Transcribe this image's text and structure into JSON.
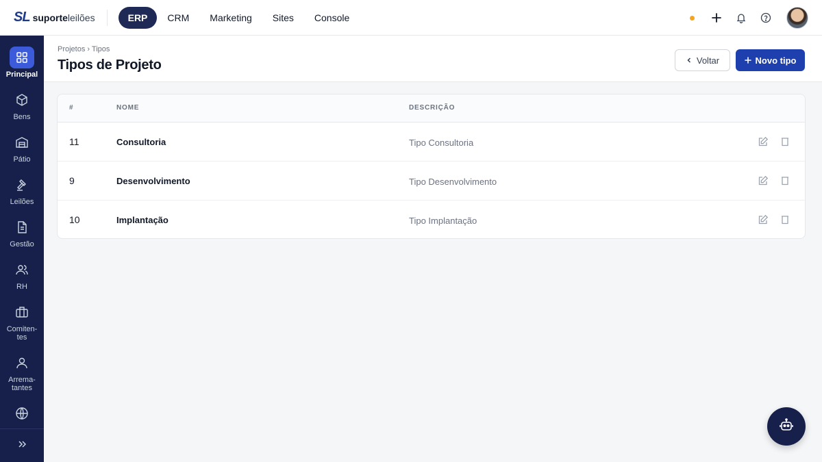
{
  "brand": {
    "mark": "SL",
    "word_bold": "suporte",
    "word_light": "leilões"
  },
  "topnav": {
    "tabs": [
      {
        "label": "ERP",
        "active": true
      },
      {
        "label": "CRM",
        "active": false
      },
      {
        "label": "Marketing",
        "active": false
      },
      {
        "label": "Sites",
        "active": false
      },
      {
        "label": "Console",
        "active": false
      }
    ],
    "status_dot_color": "#f5a524",
    "icons": [
      "plus-icon",
      "bell-icon",
      "help-icon"
    ]
  },
  "sidebar": {
    "items": [
      {
        "label": "Principal",
        "icon": "grid-icon",
        "active": true
      },
      {
        "label": "Bens",
        "icon": "cube-icon"
      },
      {
        "label": "Pátio",
        "icon": "warehouse-icon"
      },
      {
        "label": "Leilões",
        "icon": "gavel-icon"
      },
      {
        "label": "Gestão",
        "icon": "document-icon"
      },
      {
        "label": "RH",
        "icon": "users-icon"
      },
      {
        "label": "Comiten-\ntes",
        "icon": "briefcase-icon"
      },
      {
        "label": "Arrema-\ntantes",
        "icon": "user-icon"
      },
      {
        "label": "",
        "icon": "globe-icon"
      }
    ],
    "collapse_icon": "chevrons-right-icon"
  },
  "page": {
    "breadcrumb": "Projetos › Tipos",
    "title": "Tipos de Projeto",
    "back_label": "Voltar",
    "new_label": "Novo tipo"
  },
  "table": {
    "columns": [
      "#",
      "NOME",
      "DESCRIÇÃO"
    ],
    "rows": [
      {
        "id": "11",
        "name": "Consultoria",
        "description": "Tipo Consultoria"
      },
      {
        "id": "9",
        "name": "Desenvolvimento",
        "description": "Tipo Desenvolvimento"
      },
      {
        "id": "10",
        "name": "Implantação",
        "description": "Tipo Implantação"
      }
    ]
  },
  "colors": {
    "sidebar_bg": "#16204a",
    "primary": "#1e40af",
    "active_tab": "#1e2a55",
    "sidebar_active": "#3b5bdb"
  }
}
